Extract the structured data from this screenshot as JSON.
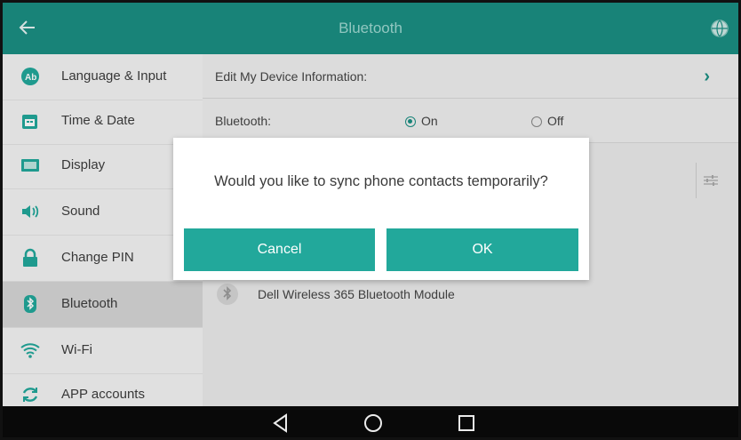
{
  "header": {
    "title": "Bluetooth"
  },
  "sidebar": {
    "items": [
      {
        "label": "Language & Input",
        "icon": "language-icon"
      },
      {
        "label": "Time & Date",
        "icon": "calendar-icon"
      },
      {
        "label": "Display",
        "icon": "display-icon"
      },
      {
        "label": "Sound",
        "icon": "speaker-icon"
      },
      {
        "label": "Change PIN",
        "icon": "lock-icon"
      },
      {
        "label": "Bluetooth",
        "icon": "bluetooth-icon",
        "active": true
      },
      {
        "label": "Wi-Fi",
        "icon": "wifi-icon"
      },
      {
        "label": "APP accounts",
        "icon": "sync-icon"
      }
    ]
  },
  "main": {
    "edit_device_label": "Edit My Device Information:",
    "bluetooth_label": "Bluetooth:",
    "bluetooth_on": "On",
    "bluetooth_off": "Off",
    "bluetooth_state": "On",
    "device_name": "Dell Wireless 365 Bluetooth Module"
  },
  "dialog": {
    "message": "Would you like to sync phone contacts temporarily?",
    "cancel_label": "Cancel",
    "ok_label": "OK"
  },
  "colors": {
    "accent": "#1b8f83",
    "button": "#22a89b"
  }
}
